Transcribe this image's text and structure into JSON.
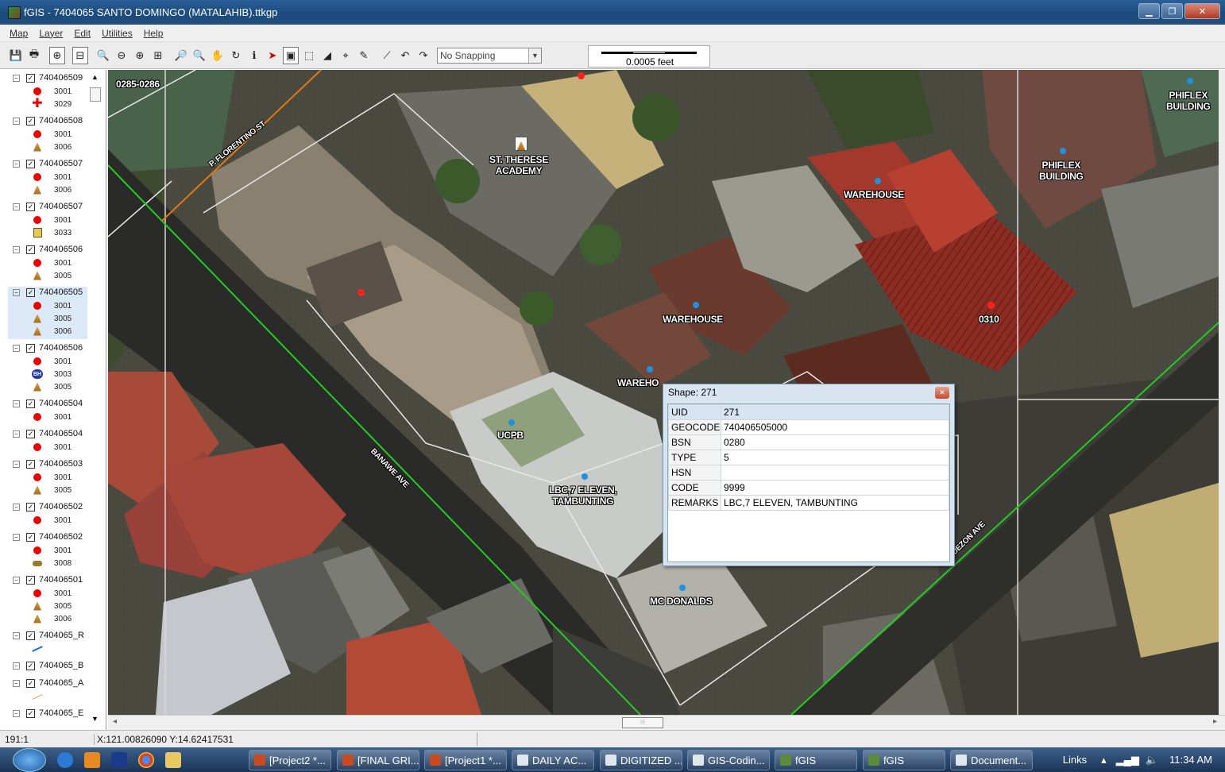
{
  "window": {
    "title": "fGIS - 7404065 SANTO DOMINGO (MATALAHIB).ttkgp"
  },
  "menu": [
    "Map",
    "Layer",
    "Edit",
    "Utilities",
    "Help"
  ],
  "toolbar": {
    "snapping": "No Snapping",
    "scale_label": "0.0005 feet"
  },
  "legend": {
    "layers": [
      {
        "name": "740406509",
        "symbols": [
          {
            "icon": "red-dot",
            "code": "3001"
          },
          {
            "icon": "red-cross",
            "code": "3029"
          }
        ]
      },
      {
        "name": "740406508",
        "symbols": [
          {
            "icon": "red-dot",
            "code": "3001"
          },
          {
            "icon": "person",
            "code": "3006"
          }
        ]
      },
      {
        "name": "740406507",
        "symbols": [
          {
            "icon": "red-dot",
            "code": "3001"
          },
          {
            "icon": "person",
            "code": "3006"
          }
        ]
      },
      {
        "name": "740406507",
        "symbols": [
          {
            "icon": "red-dot",
            "code": "3001"
          },
          {
            "icon": "building",
            "code": "3033"
          }
        ]
      },
      {
        "name": "740406506",
        "symbols": [
          {
            "icon": "red-dot",
            "code": "3001"
          },
          {
            "icon": "person",
            "code": "3005"
          }
        ]
      },
      {
        "name": "740406505",
        "symbols": [
          {
            "icon": "red-dot",
            "code": "3001"
          },
          {
            "icon": "person",
            "code": "3005"
          },
          {
            "icon": "person",
            "code": "3006"
          }
        ]
      },
      {
        "name": "740406506",
        "symbols": [
          {
            "icon": "red-dot",
            "code": "3001"
          },
          {
            "icon": "bh-badge",
            "code": "3003"
          },
          {
            "icon": "person",
            "code": "3005"
          }
        ]
      },
      {
        "name": "740406504",
        "symbols": [
          {
            "icon": "red-dot",
            "code": "3001"
          }
        ]
      },
      {
        "name": "740406504",
        "symbols": [
          {
            "icon": "red-dot",
            "code": "3001"
          }
        ]
      },
      {
        "name": "740406503",
        "symbols": [
          {
            "icon": "red-dot",
            "code": "3001"
          },
          {
            "icon": "person",
            "code": "3005"
          }
        ]
      },
      {
        "name": "740406502",
        "symbols": [
          {
            "icon": "red-dot",
            "code": "3001"
          }
        ]
      },
      {
        "name": "740406502",
        "symbols": [
          {
            "icon": "red-dot",
            "code": "3001"
          },
          {
            "icon": "car",
            "code": "3008"
          }
        ]
      },
      {
        "name": "740406501",
        "symbols": [
          {
            "icon": "red-dot",
            "code": "3001"
          },
          {
            "icon": "person",
            "code": "3005"
          },
          {
            "icon": "person",
            "code": "3006"
          }
        ]
      },
      {
        "name": "7404065_R",
        "symbols": [
          {
            "icon": "blue-line",
            "code": ""
          }
        ]
      },
      {
        "name": "7404065_B",
        "symbols": []
      },
      {
        "name": "7404065_A",
        "symbols": [
          {
            "icon": "orange-line",
            "code": ""
          }
        ]
      },
      {
        "name": "7404065_E",
        "symbols": []
      }
    ],
    "bh_text": "BH"
  },
  "map_labels": {
    "parcel_0285": "0285-0286",
    "p_florentino": "P. FLORENTINO ST",
    "st_therese": "ST. THERESE\nACADEMY",
    "warehouse": "WAREHOUSE",
    "phiflex": "PHIFLEX\nBUILDING",
    "parcel_0310": "0310",
    "wareho_cut": "WAREHO",
    "ucpb": "UCPB",
    "banawe": "BANAWE AVE",
    "lbc": "LBC,7 ELEVEN,\nTAMBUNTING",
    "mcdonalds": "MC DONALDS",
    "quezon": "QUEZON AVE"
  },
  "popup": {
    "title": "Shape: 271",
    "rows": [
      {
        "key": "UID",
        "value": "271"
      },
      {
        "key": "GEOCODE",
        "value": "740406505000"
      },
      {
        "key": "BSN",
        "value": "0280"
      },
      {
        "key": "TYPE",
        "value": "5"
      },
      {
        "key": "HSN",
        "value": ""
      },
      {
        "key": "CODE",
        "value": "9999"
      },
      {
        "key": "REMARKS",
        "value": "LBC,7 ELEVEN, TAMBUNTING"
      }
    ]
  },
  "status": {
    "scale": "191:1",
    "coords": "X:121.00826090 Y:14.62417531"
  },
  "taskbar": {
    "items": [
      "[Project2 *...",
      "[FINAL GRI...",
      "[Project1 *...",
      "DAILY AC...",
      "DIGITIZED ...",
      "GIS-Codin...",
      "fGIS",
      "fGIS",
      "Document..."
    ],
    "links": "Links",
    "time": "11:34 AM"
  },
  "colors": {
    "titlebar": "#1c4a7c",
    "road_green": "#22cc22",
    "road_orange": "#e07a10",
    "point_red": "#ff2020",
    "point_blue": "#2090e0"
  }
}
